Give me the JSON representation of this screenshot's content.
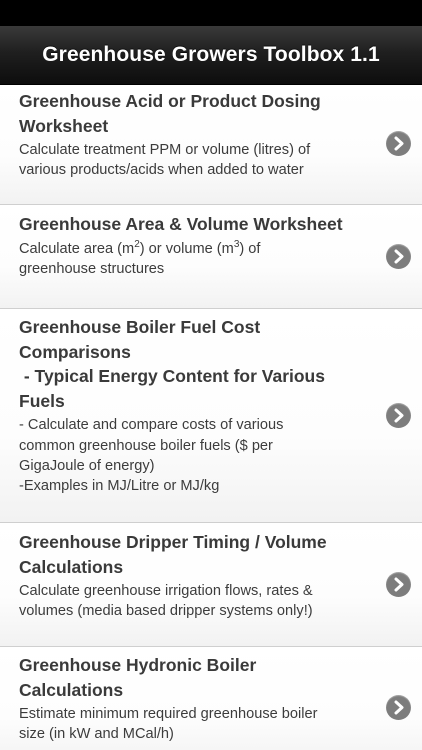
{
  "nav": {
    "title": "Greenhouse Growers Toolbox 1.1"
  },
  "rows": [
    {
      "title_lines": [
        "Greenhouse Acid or Product Dosing",
        "Worksheet"
      ],
      "subtitle_lines": [
        "Calculate treatment PPM or volume (litres) of",
        "various products/acids when added to water"
      ]
    },
    {
      "title_lines": [
        "Greenhouse Area & Volume Worksheet"
      ],
      "subtitle_parts": [
        "Calculate area (m",
        "2",
        ") or volume (m",
        "3",
        ") of"
      ],
      "subtitle_lines": [
        "greenhouse structures"
      ]
    },
    {
      "title_lines": [
        "Greenhouse Boiler Fuel Cost",
        "Comparisons",
        " - Typical Energy Content for Various",
        "Fuels"
      ],
      "subtitle_lines": [
        "- Calculate and compare costs of various",
        "common greenhouse boiler fuels ($ per",
        "GigaJoule of energy)",
        "-Examples in MJ/Litre or MJ/kg"
      ]
    },
    {
      "title_lines": [
        "Greenhouse Dripper Timing / Volume",
        "Calculations"
      ],
      "subtitle_lines": [
        "Calculate greenhouse irrigation flows, rates &",
        "volumes (media based dripper systems only!)"
      ]
    },
    {
      "title_lines": [
        "Greenhouse Hydronic Boiler",
        "Calculations"
      ],
      "subtitle_lines": [
        "Estimate minimum required greenhouse boiler",
        "size (in kW and MCal/h)"
      ]
    }
  ]
}
